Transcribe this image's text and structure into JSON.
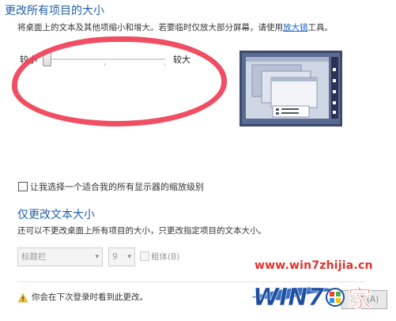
{
  "section_size": {
    "title": "更改所有项目的大小",
    "description_prefix": "将桌面上的文本及其他项缩小和增大。若要临时仅放大部分屏幕，请使用",
    "magnifier_link": "放大镜",
    "description_suffix": "工具。",
    "slider": {
      "min_label": "较小",
      "max_label": "较大",
      "value_fraction": 0.0
    }
  },
  "custom_scaling_checkbox": {
    "label": "让我选择一个适合我的所有显示器的缩放级别",
    "checked": false
  },
  "section_text": {
    "title": "仅更改文本大小",
    "description": "还可以不更改桌面上所有项目的大小，只更改指定项目的文本大小。",
    "item_select": "标题栏",
    "size_select": "9",
    "bold_label": "粗体(B)",
    "apply_button": "应用(A)"
  },
  "notice": {
    "text": "你会在下次登录时看到此更改。"
  },
  "watermark": {
    "url": "www.win7zhijia.cn",
    "logo_text": "WIN7",
    "logo_suffix": "家"
  },
  "colors": {
    "heading": "#1f5fa8",
    "annotation": "#ef3f56",
    "watermark_red": "#e0322a",
    "preview_frame": "#3d4a6e"
  }
}
